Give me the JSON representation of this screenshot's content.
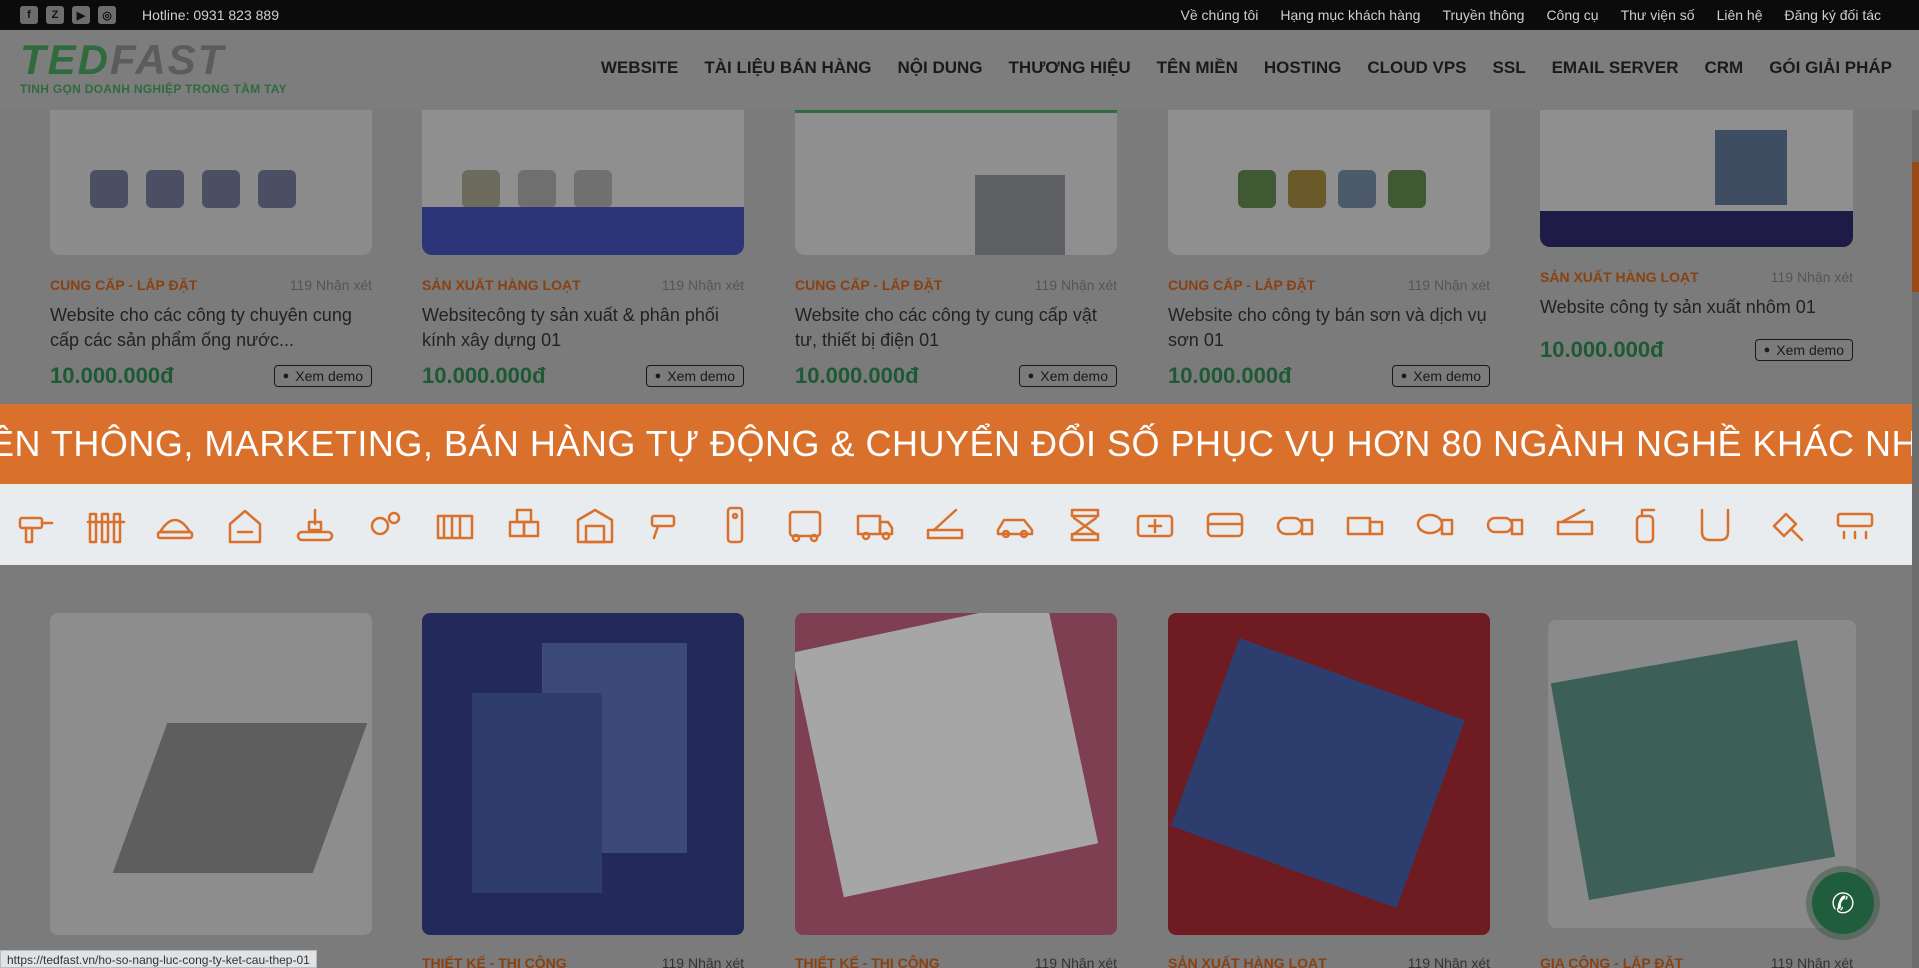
{
  "topbar": {
    "social": [
      {
        "icon": "facebook-icon",
        "glyph": "f"
      },
      {
        "icon": "zalo-icon",
        "glyph": "Z"
      },
      {
        "icon": "youtube-icon",
        "glyph": "▶"
      },
      {
        "icon": "instagram-icon",
        "glyph": "◎"
      }
    ],
    "hotline": "Hotline: 0931 823 889",
    "links": [
      "Về chúng tôi",
      "Hạng mục khách hàng",
      "Truyền thông",
      "Công cụ",
      "Thư viện số",
      "Liên hệ",
      "Đăng ký đối tác"
    ]
  },
  "header": {
    "logo_part1": "TED",
    "logo_part2": "FAST",
    "tagline": "TINH GỌN DOANH NGHIỆP TRONG TẦM TAY",
    "nav": [
      "WEBSITE",
      "TÀI LIỆU BÁN HÀNG",
      "NỘI DUNG",
      "THƯƠNG HIỆU",
      "TÊN MIỀN",
      "HOSTING",
      "CLOUD VPS",
      "SSL",
      "EMAIL SERVER",
      "CRM",
      "GÓI GIẢI PHÁP"
    ]
  },
  "cards": [
    {
      "category": "CUNG CẤP - LẮP ĐẶT",
      "reviews": "119 Nhận xét",
      "title": "Website cho các công ty chuyên cung cấp các sản phẩm ống nước...",
      "price": "10.000.000đ",
      "demo": "Xem demo"
    },
    {
      "category": "SẢN XUẤT HÀNG LOẠT",
      "reviews": "119 Nhận xét",
      "title": "Websitecông ty sản xuất & phân phối kính xây dựng 01",
      "price": "10.000.000đ",
      "demo": "Xem demo"
    },
    {
      "category": "CUNG CẤP - LẮP ĐẶT",
      "reviews": "119 Nhận xét",
      "title": "Website cho các công ty cung cấp vật tư, thiết bị điện 01",
      "price": "10.000.000đ",
      "demo": "Xem demo"
    },
    {
      "category": "CUNG CẤP - LẮP ĐẶT",
      "reviews": "119 Nhận xét",
      "title": "Website cho công ty bán sơn và dịch vụ sơn 01",
      "price": "10.000.000đ",
      "demo": "Xem demo"
    },
    {
      "category": "SẢN XUẤT HÀNG LOẠT",
      "reviews": "119 Nhận xét",
      "title": "Website công ty sản xuất nhôm 01",
      "price": "10.000.000đ",
      "demo": "Xem demo"
    }
  ],
  "banner_text": "ỀN THÔNG, MARKETING, BÁN HÀNG TỰ ĐỘNG & CHUYỂN ĐỔI SỐ PHỤC VỤ HƠN 80 NGÀNH NGHỀ KHÁC NH",
  "industry_icons": [
    "drill-icon",
    "fence-icon",
    "hardhat-icon",
    "house-tools-icon",
    "conveyor-icon",
    "gears-icon",
    "container-icon",
    "boxes-icon",
    "warehouse-icon",
    "cctv-icon",
    "remote-icon",
    "truck-front-icon",
    "delivery-truck-icon",
    "crane-truck-icon",
    "car-icon",
    "scissor-lift-icon",
    "ambulance-icon",
    "bus-icon",
    "tanker-truck-icon",
    "dump-truck-icon",
    "mixer-truck-icon",
    "tank-truck-icon",
    "fire-truck-icon",
    "extinguisher-icon",
    "pipe-icon",
    "plug-icon",
    "air-conditioner-icon"
  ],
  "lower_cards": [
    {
      "category": "",
      "reviews": ""
    },
    {
      "category": "THIẾT KẾ - THI CÔNG",
      "reviews": "119 Nhận xét"
    },
    {
      "category": "THIẾT KẾ - THI CÔNG",
      "reviews": "119 Nhận xét"
    },
    {
      "category": "SẢN XUẤT HÀNG LOẠT",
      "reviews": "119 Nhận xét"
    },
    {
      "category": "GIA CÔNG - LẮP ĐẶT",
      "reviews": "119 Nhận xét"
    }
  ],
  "status_url": "https://tedfast.vn/ho-so-nang-luc-cong-ty-ket-cau-thep-01",
  "fab_icon": "phone-icon",
  "colors": {
    "accent": "#d9702b",
    "brand_green": "#2f6b3d",
    "dark": "#0b0b0b"
  }
}
